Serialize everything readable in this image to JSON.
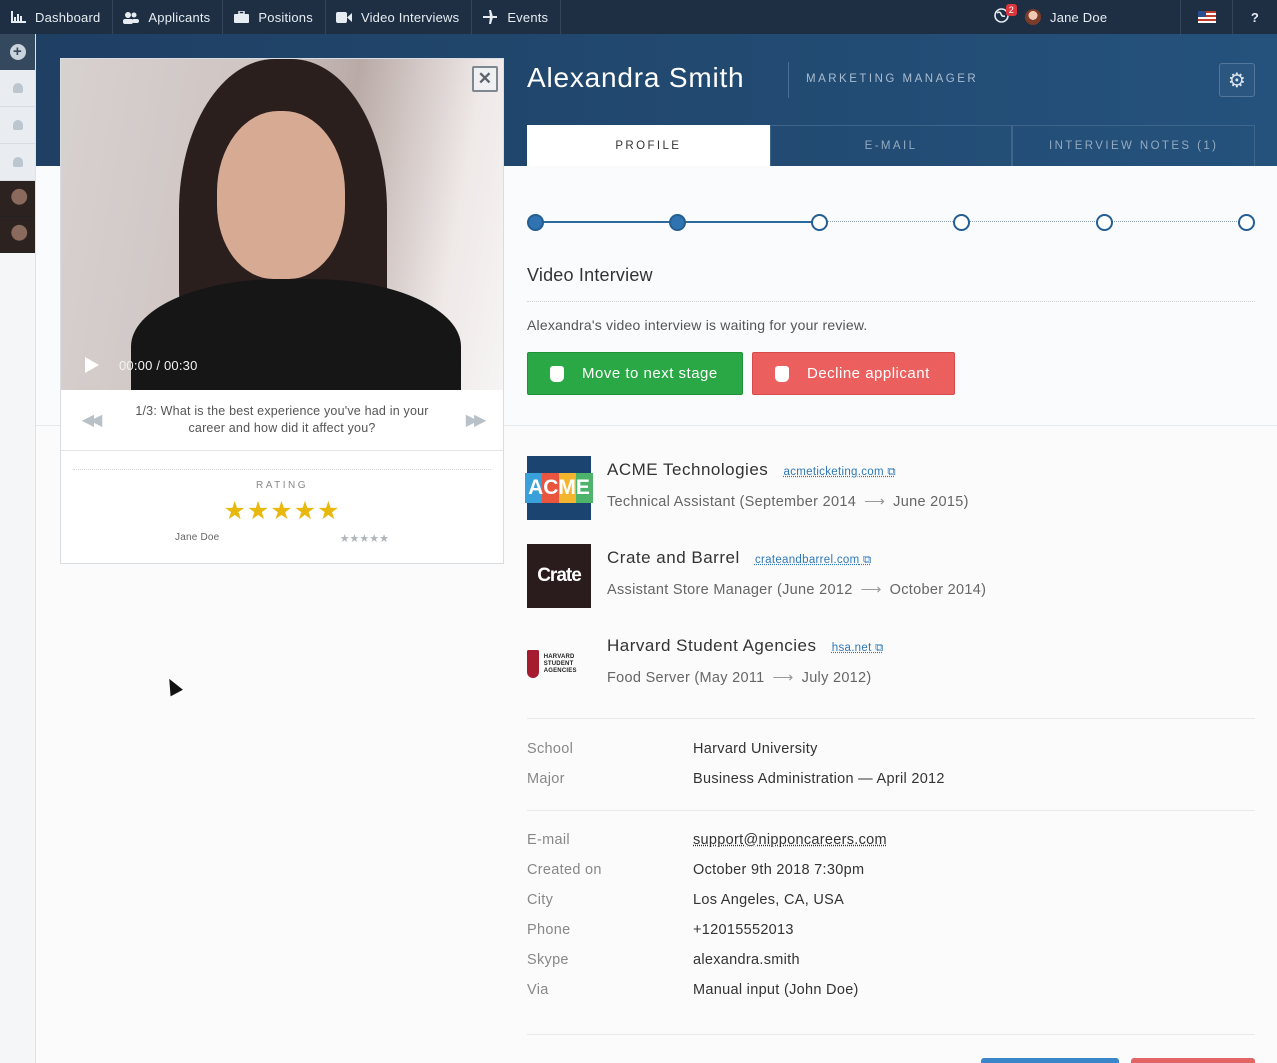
{
  "nav": {
    "items": [
      {
        "label": "Dashboard",
        "icon": "chart-icon"
      },
      {
        "label": "Applicants",
        "icon": "users-icon"
      },
      {
        "label": "Positions",
        "icon": "briefcase-icon"
      },
      {
        "label": "Video Interviews",
        "icon": "video-camera-icon"
      },
      {
        "label": "Events",
        "icon": "plane-icon"
      }
    ],
    "notifications": "2",
    "user": "Jane Doe",
    "help": "?"
  },
  "candidate": {
    "name": "Alexandra Smith",
    "role": "MARKETING MANAGER"
  },
  "tabs": [
    "PROFILE",
    "E-MAIL",
    "INTERVIEW NOTES (1)"
  ],
  "stages": {
    "total": 6,
    "completed": 2,
    "current": 3
  },
  "video": {
    "time": "00:00 / 00:30",
    "close": "✕",
    "question": "1/3: What is the best experience you've had in your career and how did it affect you?"
  },
  "rating": {
    "label": "RATING",
    "stars": "★★★★★",
    "stars_value": 5,
    "rater": "Jane Doe",
    "rater_stars": "★★★★★",
    "rater_stars_value": 0
  },
  "stage": {
    "title": "Video Interview",
    "text": "Alexandra's video interview is waiting for your review.",
    "next": "Move to next stage",
    "decline": "Decline applicant"
  },
  "jobs": [
    {
      "company": "ACME Technologies",
      "link": "acmeticketing.com",
      "title": "Technical Assistant (September 2014",
      "end": "June 2015)",
      "logo": "ACME"
    },
    {
      "company": "Crate and Barrel",
      "link": "crateandbarrel.com",
      "title": "Assistant Store Manager (June 2012",
      "end": "October 2014)",
      "logo": "Crate"
    },
    {
      "company": "Harvard Student Agencies",
      "link": "hsa.net",
      "title": "Food Server (May 2011",
      "end": "July 2012)",
      "logo": "HARVARD STUDENT AGENCIES"
    }
  ],
  "education": [
    {
      "k": "School",
      "v": "Harvard University"
    },
    {
      "k": "Major",
      "v": "Business Administration — April 2012"
    }
  ],
  "details": [
    {
      "k": "E-mail",
      "v": "support@nipponcareers.com"
    },
    {
      "k": "Created on",
      "v": "October 9th 2018 7:30pm"
    },
    {
      "k": "City",
      "v": "Los Angeles, CA, USA"
    },
    {
      "k": "Phone",
      "v": "+12015552013"
    },
    {
      "k": "Skype",
      "v": "alexandra.smith"
    },
    {
      "k": "Via",
      "v": "Manual input (John Doe)"
    }
  ],
  "colors": {
    "accent": "#2f73b0",
    "positive": "#2aa845",
    "negative": "#eb5f5f",
    "navbar": "#1e2f44"
  }
}
